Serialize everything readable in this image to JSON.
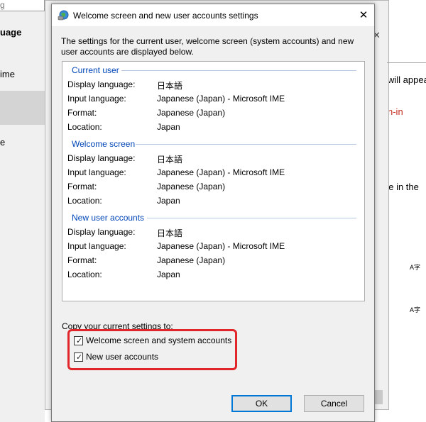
{
  "background": {
    "search_fragment": "g",
    "title_fragment": "uage",
    "nav_item_1": "ime",
    "nav_item_2": "e",
    "main_text_1": "will appea",
    "main_text_2": "n-in",
    "main_text_3": "ge in the"
  },
  "dialog": {
    "title": "Welcome screen and new user accounts settings",
    "close_symbol": "✕",
    "description": "The settings for the current user, welcome screen (system accounts) and new user accounts are displayed below.",
    "groups": [
      {
        "header": "Current user",
        "rows": [
          {
            "label": "Display language:",
            "value": "日本語"
          },
          {
            "label": "Input language:",
            "value": "Japanese (Japan) - Microsoft IME"
          },
          {
            "label": "Format:",
            "value": "Japanese (Japan)"
          },
          {
            "label": "Location:",
            "value": "Japan"
          }
        ]
      },
      {
        "header": "Welcome screen",
        "rows": [
          {
            "label": "Display language:",
            "value": "日本語"
          },
          {
            "label": "Input language:",
            "value": "Japanese (Japan) - Microsoft IME"
          },
          {
            "label": "Format:",
            "value": "Japanese (Japan)"
          },
          {
            "label": "Location:",
            "value": "Japan"
          }
        ]
      },
      {
        "header": "New user accounts",
        "rows": [
          {
            "label": "Display language:",
            "value": "日本語"
          },
          {
            "label": "Input language:",
            "value": "Japanese (Japan) - Microsoft IME"
          },
          {
            "label": "Format:",
            "value": "Japanese (Japan)"
          },
          {
            "label": "Location:",
            "value": "Japan"
          }
        ]
      }
    ],
    "copy_label": "Copy your current settings to:",
    "checkboxes": [
      {
        "label": "Welcome screen and system accounts",
        "checked": true
      },
      {
        "label": "New user accounts",
        "checked": true
      }
    ],
    "ok_label": "OK",
    "cancel_label": "Cancel"
  },
  "colors": {
    "group_header": "#0046b8",
    "highlight_border": "#e0262b",
    "default_button_border": "#0078d7"
  }
}
